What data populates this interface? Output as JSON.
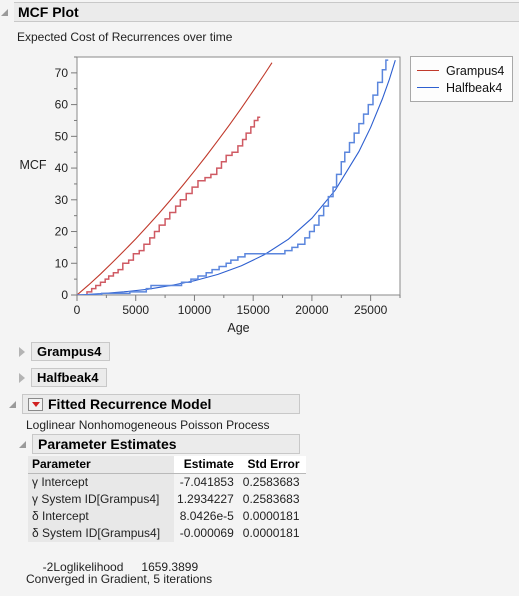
{
  "window": {
    "title": "MCF Plot",
    "subtitle": "Expected Cost of Recurrences over time"
  },
  "nodes": {
    "grampus": "Grampus4",
    "halfbeak": "Halfbeak4",
    "fitted_model": "Fitted Recurrence Model",
    "model_desc": "Loglinear Nonhomogeneous Poisson Process",
    "parameter_estimates": "Parameter Estimates"
  },
  "colors": {
    "grampus": "#c0392b",
    "grampus_step": "#cf5a63",
    "halfbeak": "#2d5fd0",
    "halfbeak_step": "#5b86dd",
    "header_bg": "#ebebeb",
    "header_border": "#c8c8c8",
    "menu_red": "#d02020",
    "axis": "#7a7a7a"
  },
  "table": {
    "columns": [
      "Parameter",
      "Estimate",
      "Std Error"
    ],
    "rows": [
      {
        "parameter": "γ Intercept",
        "estimate": "-7.041853",
        "std_error": "0.2583683"
      },
      {
        "parameter": "γ System ID[Grampus4]",
        "estimate": "1.2934227",
        "std_error": "0.2583683"
      },
      {
        "parameter": "δ Intercept",
        "estimate": "8.0426e-5",
        "std_error": "0.0000181"
      },
      {
        "parameter": "δ System ID[Grampus4]",
        "estimate": "-0.000069",
        "std_error": "0.0000181"
      }
    ]
  },
  "stats": {
    "loglik_label": "-2Loglikelihood",
    "loglik_value": "1659.3899",
    "converged": "Converged in Gradient, 5 iterations"
  },
  "chart_data": {
    "type": "line",
    "title": "MCF Plot",
    "subtitle": "Expected Cost of Recurrences over time",
    "xlabel": "Age",
    "ylabel": "MCF",
    "xlim": [
      0,
      27500
    ],
    "ylim": [
      0,
      75
    ],
    "xticks": [
      0,
      5000,
      10000,
      15000,
      20000,
      25000
    ],
    "yticks": [
      0,
      10,
      20,
      30,
      40,
      50,
      60,
      70
    ],
    "xminor_step": 2500,
    "yminor_step": 5,
    "grid": false,
    "legend_position": "outside-right",
    "series": [
      {
        "name": "Grampus4",
        "color": "#c0392b",
        "style": "fitted-curve",
        "points": [
          [
            0,
            0.0
          ],
          [
            1000,
            3.2
          ],
          [
            2000,
            6.6
          ],
          [
            3000,
            10.2
          ],
          [
            4000,
            13.9
          ],
          [
            5000,
            17.7
          ],
          [
            6000,
            21.7
          ],
          [
            7000,
            25.8
          ],
          [
            8000,
            30.1
          ],
          [
            9000,
            34.5
          ],
          [
            10000,
            39.1
          ],
          [
            11000,
            43.8
          ],
          [
            12000,
            48.7
          ],
          [
            13000,
            53.7
          ],
          [
            14000,
            58.9
          ],
          [
            15000,
            64.3
          ],
          [
            16000,
            69.8
          ],
          [
            16600,
            73.2
          ]
        ]
      },
      {
        "name": "Grampus4 MCF steps",
        "color": "#cf5a63",
        "style": "step",
        "points": [
          [
            0,
            0
          ],
          [
            700,
            0
          ],
          [
            850,
            1
          ],
          [
            1150,
            1
          ],
          [
            1250,
            2
          ],
          [
            1500,
            2
          ],
          [
            1600,
            3
          ],
          [
            1900,
            3
          ],
          [
            2000,
            4
          ],
          [
            2300,
            4
          ],
          [
            2400,
            5
          ],
          [
            2600,
            5
          ],
          [
            2700,
            6
          ],
          [
            3000,
            6
          ],
          [
            3100,
            7
          ],
          [
            3400,
            7
          ],
          [
            3500,
            8
          ],
          [
            3800,
            8
          ],
          [
            3900,
            10
          ],
          [
            4300,
            10
          ],
          [
            4400,
            11
          ],
          [
            4700,
            11
          ],
          [
            4800,
            13
          ],
          [
            5200,
            13
          ],
          [
            5300,
            14
          ],
          [
            5600,
            14
          ],
          [
            5700,
            16
          ],
          [
            6100,
            16
          ],
          [
            6200,
            18
          ],
          [
            6500,
            18
          ],
          [
            6600,
            20
          ],
          [
            6900,
            20
          ],
          [
            7000,
            22
          ],
          [
            7400,
            22
          ],
          [
            7500,
            24
          ],
          [
            7800,
            24
          ],
          [
            7900,
            26
          ],
          [
            8300,
            26
          ],
          [
            8400,
            28
          ],
          [
            8700,
            28
          ],
          [
            8800,
            30
          ],
          [
            9200,
            30
          ],
          [
            9300,
            32
          ],
          [
            9700,
            32
          ],
          [
            9800,
            34
          ],
          [
            10200,
            34
          ],
          [
            10300,
            36
          ],
          [
            10800,
            36
          ],
          [
            10900,
            37
          ],
          [
            11300,
            37
          ],
          [
            11400,
            38
          ],
          [
            11800,
            38
          ],
          [
            11900,
            40
          ],
          [
            12200,
            40
          ],
          [
            12300,
            42
          ],
          [
            12600,
            42
          ],
          [
            12700,
            44
          ],
          [
            13100,
            44
          ],
          [
            13200,
            45
          ],
          [
            13600,
            45
          ],
          [
            13700,
            47
          ],
          [
            14000,
            47
          ],
          [
            14100,
            49
          ],
          [
            14300,
            49
          ],
          [
            14400,
            51
          ],
          [
            14700,
            51
          ],
          [
            14800,
            53
          ],
          [
            15000,
            53
          ],
          [
            15100,
            55
          ],
          [
            15300,
            55
          ],
          [
            15400,
            56
          ],
          [
            15600,
            56
          ]
        ]
      },
      {
        "name": "Halfbeak4",
        "color": "#2d5fd0",
        "style": "fitted-curve",
        "points": [
          [
            0,
            0.0
          ],
          [
            2000,
            0.4
          ],
          [
            4000,
            1.0
          ],
          [
            6000,
            1.8
          ],
          [
            8000,
            3.0
          ],
          [
            10000,
            4.5
          ],
          [
            12000,
            6.5
          ],
          [
            14000,
            9.2
          ],
          [
            16000,
            12.8
          ],
          [
            18000,
            17.6
          ],
          [
            20000,
            24.2
          ],
          [
            22000,
            33.1
          ],
          [
            24000,
            45.2
          ],
          [
            25000,
            52.8
          ],
          [
            26000,
            61.8
          ],
          [
            26600,
            68.0
          ],
          [
            27100,
            74.0
          ]
        ]
      },
      {
        "name": "Halfbeak4 MCF steps",
        "color": "#5b86dd",
        "style": "step",
        "points": [
          [
            0,
            0
          ],
          [
            2000,
            0
          ],
          [
            2100,
            0.5
          ],
          [
            4400,
            0.5
          ],
          [
            4500,
            1
          ],
          [
            5800,
            1
          ],
          [
            5900,
            2
          ],
          [
            6200,
            2
          ],
          [
            6300,
            3
          ],
          [
            8800,
            3
          ],
          [
            8900,
            4
          ],
          [
            9600,
            4
          ],
          [
            9700,
            5
          ],
          [
            10200,
            5
          ],
          [
            10300,
            6
          ],
          [
            10900,
            6
          ],
          [
            11000,
            7
          ],
          [
            11400,
            7
          ],
          [
            11500,
            8
          ],
          [
            12000,
            8
          ],
          [
            12100,
            9
          ],
          [
            12600,
            9
          ],
          [
            12700,
            10
          ],
          [
            13000,
            10
          ],
          [
            13100,
            11
          ],
          [
            13600,
            11
          ],
          [
            13700,
            12
          ],
          [
            14200,
            12
          ],
          [
            14300,
            13
          ],
          [
            17600,
            13
          ],
          [
            17700,
            14
          ],
          [
            18200,
            14
          ],
          [
            18300,
            15
          ],
          [
            18700,
            15
          ],
          [
            18800,
            16
          ],
          [
            19300,
            16
          ],
          [
            19400,
            18
          ],
          [
            19700,
            18
          ],
          [
            19800,
            20
          ],
          [
            20100,
            20
          ],
          [
            20200,
            22
          ],
          [
            20500,
            22
          ],
          [
            20600,
            25
          ],
          [
            20900,
            25
          ],
          [
            21000,
            28
          ],
          [
            21300,
            28
          ],
          [
            21400,
            31
          ],
          [
            21700,
            31
          ],
          [
            21800,
            34
          ],
          [
            22000,
            34
          ],
          [
            22100,
            38
          ],
          [
            22400,
            38
          ],
          [
            22500,
            42
          ],
          [
            22700,
            42
          ],
          [
            22800,
            45
          ],
          [
            23100,
            45
          ],
          [
            23200,
            48
          ],
          [
            23500,
            48
          ],
          [
            23600,
            51
          ],
          [
            23900,
            51
          ],
          [
            24000,
            54
          ],
          [
            24300,
            54
          ],
          [
            24400,
            57
          ],
          [
            24700,
            57
          ],
          [
            24800,
            60
          ],
          [
            25100,
            60
          ],
          [
            25200,
            63
          ],
          [
            25500,
            63
          ],
          [
            25600,
            67
          ],
          [
            25900,
            67
          ],
          [
            26000,
            71
          ],
          [
            26200,
            71
          ],
          [
            26300,
            74
          ],
          [
            26500,
            74
          ]
        ]
      }
    ]
  }
}
